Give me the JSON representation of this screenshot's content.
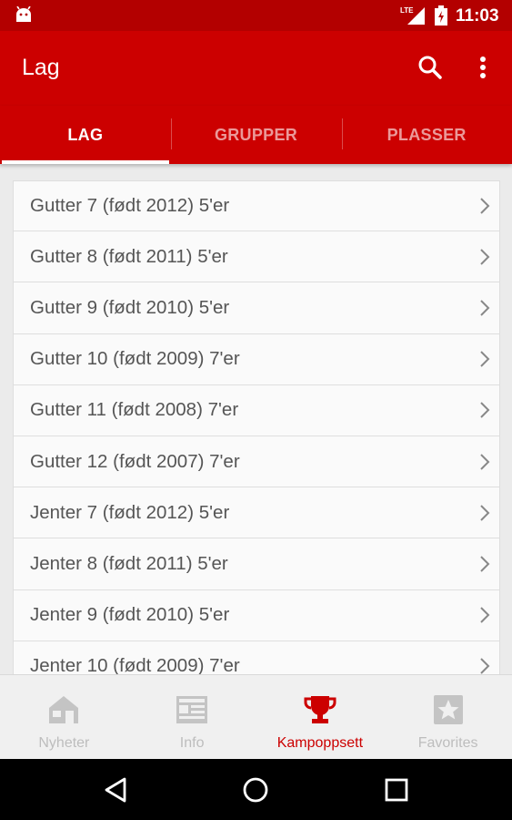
{
  "status_bar": {
    "time": "11:03",
    "network": "LTE",
    "icons": [
      "android-icon",
      "signal-icon",
      "battery-icon"
    ]
  },
  "toolbar": {
    "title": "Lag",
    "actions": [
      "search-icon",
      "more-vert-icon"
    ]
  },
  "tabs": [
    {
      "label": "LAG",
      "active": true
    },
    {
      "label": "GRUPPER",
      "active": false
    },
    {
      "label": "PLASSER",
      "active": false
    }
  ],
  "list": {
    "items": [
      {
        "label": "Gutter 7 (født 2012) 5'er"
      },
      {
        "label": "Gutter 8 (født 2011) 5'er"
      },
      {
        "label": "Gutter 9 (født 2010) 5'er"
      },
      {
        "label": "Gutter 10 (født 2009) 7'er"
      },
      {
        "label": "Gutter 11 (født 2008) 7'er"
      },
      {
        "label": "Gutter 12 (født 2007) 7'er"
      },
      {
        "label": "Jenter 7 (født 2012) 5'er"
      },
      {
        "label": "Jenter 8 (født 2011) 5'er"
      },
      {
        "label": "Jenter 9 (født 2010) 5'er"
      },
      {
        "label": "Jenter 10 (født 2009) 7'er"
      }
    ]
  },
  "bottom_nav": [
    {
      "label": "Nyheter",
      "icon": "home-icon",
      "active": false
    },
    {
      "label": "Info",
      "icon": "newspaper-icon",
      "active": false
    },
    {
      "label": "Kampoppsett",
      "icon": "trophy-icon",
      "active": true
    },
    {
      "label": "Favorites",
      "icon": "star-icon",
      "active": false
    }
  ],
  "colors": {
    "primary": "#cc0000",
    "primary_dark": "#b30000",
    "inactive": "#bdbdbd"
  }
}
